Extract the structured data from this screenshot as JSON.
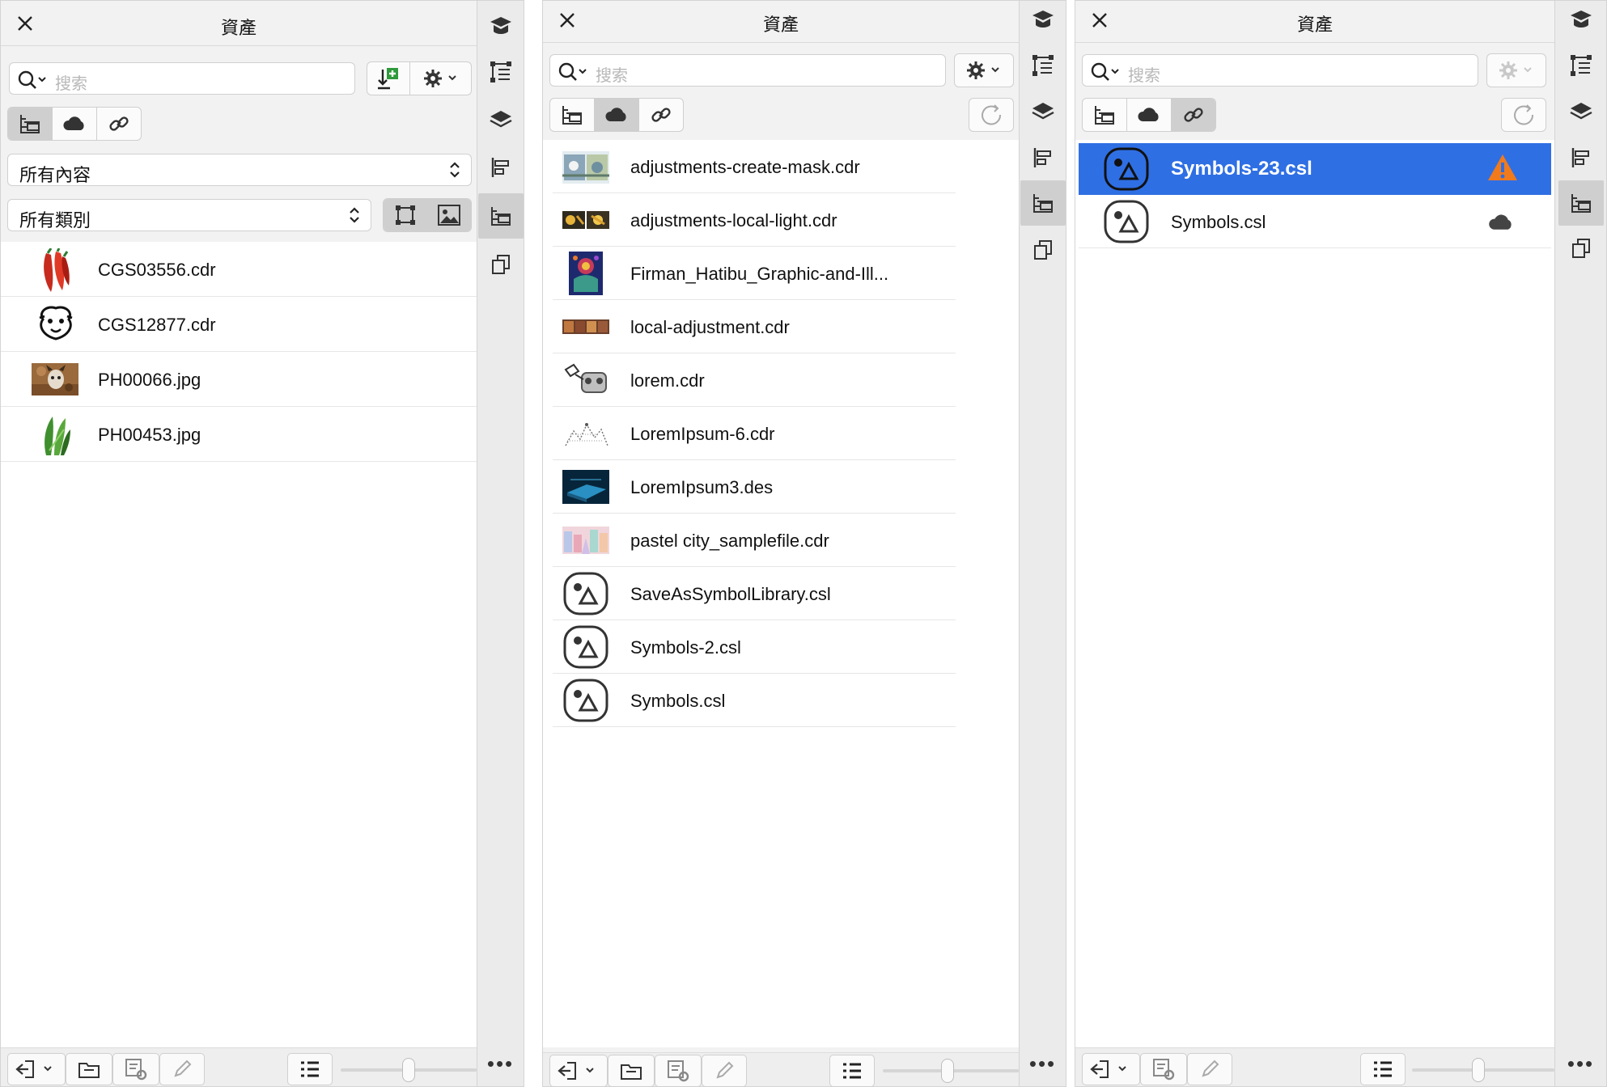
{
  "colors": {
    "selection": "#2f6fe4",
    "warning": "#f07a1c",
    "panel_bg": "#f2f2f2"
  },
  "panels": [
    {
      "title": "資產",
      "search_placeholder": "搜索",
      "content_filter": "所有內容",
      "category_filter": "所有類別",
      "items": [
        {
          "name": "CGS03556.cdr",
          "thumb": "chili-peppers-thumbnail"
        },
        {
          "name": "CGS12877.cdr",
          "thumb": "sheep-face-thumbnail"
        },
        {
          "name": "PH00066.jpg",
          "thumb": "dog-photo-thumbnail"
        },
        {
          "name": "PH00453.jpg",
          "thumb": "green-vegetables-thumbnail"
        }
      ]
    },
    {
      "title": "資產",
      "search_placeholder": "搜索",
      "items": [
        {
          "name": "adjustments-create-mask.cdr",
          "thumb": "image"
        },
        {
          "name": "adjustments-local-light.cdr",
          "thumb": "image"
        },
        {
          "name": "Firman_Hatibu_Graphic-and-Ill...",
          "thumb": "image"
        },
        {
          "name": "local-adjustment.cdr",
          "thumb": "image"
        },
        {
          "name": "lorem.cdr",
          "thumb": "image"
        },
        {
          "name": "LoremIpsum-6.cdr",
          "thumb": "image"
        },
        {
          "name": "LoremIpsum3.des",
          "thumb": "image"
        },
        {
          "name": "pastel city_samplefile.cdr",
          "thumb": "image"
        },
        {
          "name": "SaveAsSymbolLibrary.csl",
          "thumb": "symbol-library-icon"
        },
        {
          "name": "Symbols-2.csl",
          "thumb": "symbol-library-icon"
        },
        {
          "name": "Symbols.csl",
          "thumb": "symbol-library-icon"
        }
      ]
    },
    {
      "title": "資產",
      "search_placeholder": "搜索",
      "items": [
        {
          "name": "Symbols-23.csl",
          "thumb": "symbol-library-icon",
          "status": "warning-icon",
          "selected": true
        },
        {
          "name": "Symbols.csl",
          "thumb": "symbol-library-icon",
          "status": "cloud-icon",
          "selected": false
        }
      ]
    }
  ],
  "rail": {
    "more_label": "•••"
  }
}
